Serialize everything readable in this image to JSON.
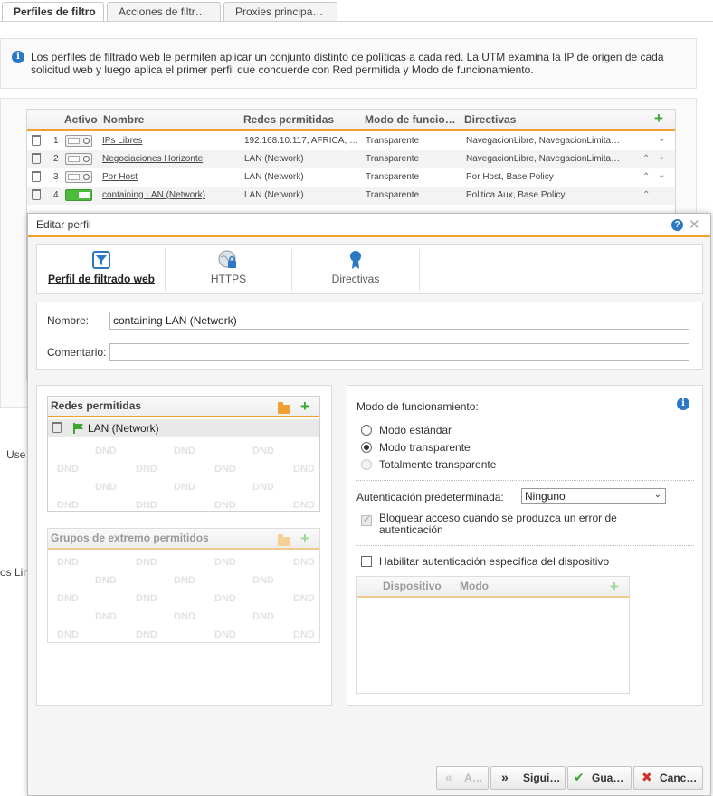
{
  "top_tabs": [
    "Perfiles de filtro",
    "Acciones de filtr…",
    "Proxies principa…"
  ],
  "info_text": "Los perfiles de filtrado web le permiten aplicar un conjunto distinto de políticas a cada red. La UTM examina la IP de origen de cada solicitud web y luego aplica el primer perfil que concuerde con Red permitida y Modo de funcionamiento.",
  "profiles_table": {
    "columns": [
      "Activo",
      "Nombre",
      "Redes permitidas",
      "Modo de funcio…",
      "Directivas"
    ],
    "rows": [
      {
        "num": "1",
        "name": "IPs Libres",
        "networks": "192.168.10.117, AFRICA, …",
        "mode": "Transparente",
        "directives": "NavegacionLibre, NavegacionLimita…",
        "active": false
      },
      {
        "num": "2",
        "name": "Negociaciones Horizonte",
        "networks": "LAN (Network)",
        "mode": "Transparente",
        "directives": "NavegacionLibre, NavegacionLimita…",
        "active": false
      },
      {
        "num": "3",
        "name": "Por Host",
        "networks": "LAN (Network)",
        "mode": "Transparente",
        "directives": "Por Host, Base Policy",
        "active": false
      },
      {
        "num": "4",
        "name": "containing LAN (Network)",
        "networks": "LAN (Network)",
        "mode": "Transparente",
        "directives": "Politica Aux, Base Policy",
        "active": true
      }
    ]
  },
  "background_fragments": [
    "Use",
    "os Lin"
  ],
  "dialog": {
    "title": "Editar perfil",
    "tabs": [
      "Perfil de filtrado web",
      "HTTPS",
      "Directivas"
    ],
    "name_label": "Nombre:",
    "name_value": "containing LAN (Network)",
    "comment_label": "Comentario:",
    "comment_value": "",
    "allowed_networks": {
      "title": "Redes permitidas",
      "items": [
        "LAN (Network)"
      ]
    },
    "endpoint_groups": {
      "title": "Grupos de extremo permitidos"
    },
    "dnd_text": "DND",
    "mode_label": "Modo de funcionamiento:",
    "modes": [
      "Modo estándar",
      "Modo transparente",
      "Totalmente transparente"
    ],
    "selected_mode": "Modo transparente",
    "auth_label": "Autenticación predeterminada:",
    "auth_value": "Ninguno",
    "block_label_1": "Bloquear acceso cuando se produzca un error de",
    "block_label_2": "autenticación",
    "device_auth_label": "Habilitar autenticación específica del dispositivo",
    "device_table_columns": [
      "Dispositivo",
      "Modo"
    ],
    "buttons": {
      "back": "A…",
      "next": "Sigui…",
      "save": "Gua…",
      "cancel": "Canc…"
    }
  },
  "colors": {
    "accent_orange": "#f0a030",
    "info_blue": "#2b78c5",
    "add_green": "#3fa535",
    "cancel_red": "#d0312d"
  }
}
